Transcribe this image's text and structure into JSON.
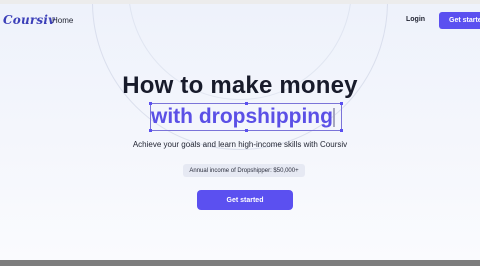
{
  "header": {
    "logo_text": "Coursiv",
    "nav_home": "Home",
    "login_label": "Login",
    "cta_label": "Get started"
  },
  "hero": {
    "headline": "How to make money",
    "highlight": "with dropshipping",
    "subtitle": "Achieve your goals and learn high-income skills with Coursiv",
    "income_badge": "Annual income of Dropshipper: $50,000+",
    "cta_label": "Get started"
  },
  "colors": {
    "accent": "#5b50f0",
    "highlight_text": "#5b50e6",
    "headline": "#181b2b",
    "background_top": "#eef2fb"
  }
}
